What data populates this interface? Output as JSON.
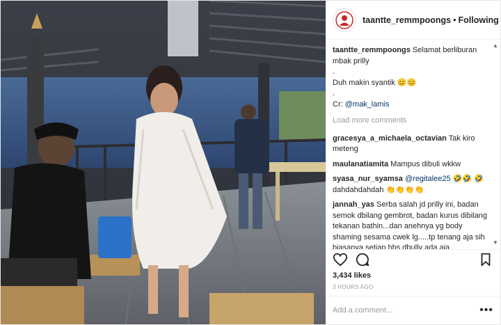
{
  "header": {
    "username": "taantte_remmpoongs",
    "separator": "•",
    "follow_status": "Following"
  },
  "caption": {
    "username": "taantte_remmpoongs",
    "line1": "Selamat berliburan mbak prilly",
    "dot1": ".",
    "line2": "Duh makin syantik 😊😊",
    "dot2": ".",
    "credit_prefix": "Cr: ",
    "credit_mention": "@mak_lamis"
  },
  "load_more": "Load more comments",
  "comments": [
    {
      "user": "gracesya_a_michaela_octavian",
      "text": "Tak kiro meteng"
    },
    {
      "user": "maulanatiamita",
      "text": "Mampus dibuli wkkw"
    },
    {
      "user": "syasa_nur_syamsa",
      "mention": "@regitalee25",
      "text": " 🤣🤣 🤣 dahdahdahdah 👏👏👏👏"
    },
    {
      "user": "jannah_yas",
      "text": "Serba salah jd prilly ini, badan semok dbilang gembrot, badan kurus dibilang tekanan bathin...dan anehnya yg body shaming sesama cwek lg.....tp tenang aja sih biasanya setiap hbs dbully ada aja keberkahan yg dia dapet dr semua itu....aamiin 🙏"
    }
  ],
  "likes": "3,434 likes",
  "time": "3 HOURS AGO",
  "add_comment_placeholder": "Add a comment...",
  "more_label": "•••",
  "icons": {
    "like": "heart-icon",
    "comment": "comment-bubble-icon",
    "save": "bookmark-icon",
    "avatar": "profile-avatar-logo"
  },
  "colors": {
    "mention": "#003569",
    "muted": "#999999",
    "text": "#262626",
    "border": "#efefef"
  }
}
